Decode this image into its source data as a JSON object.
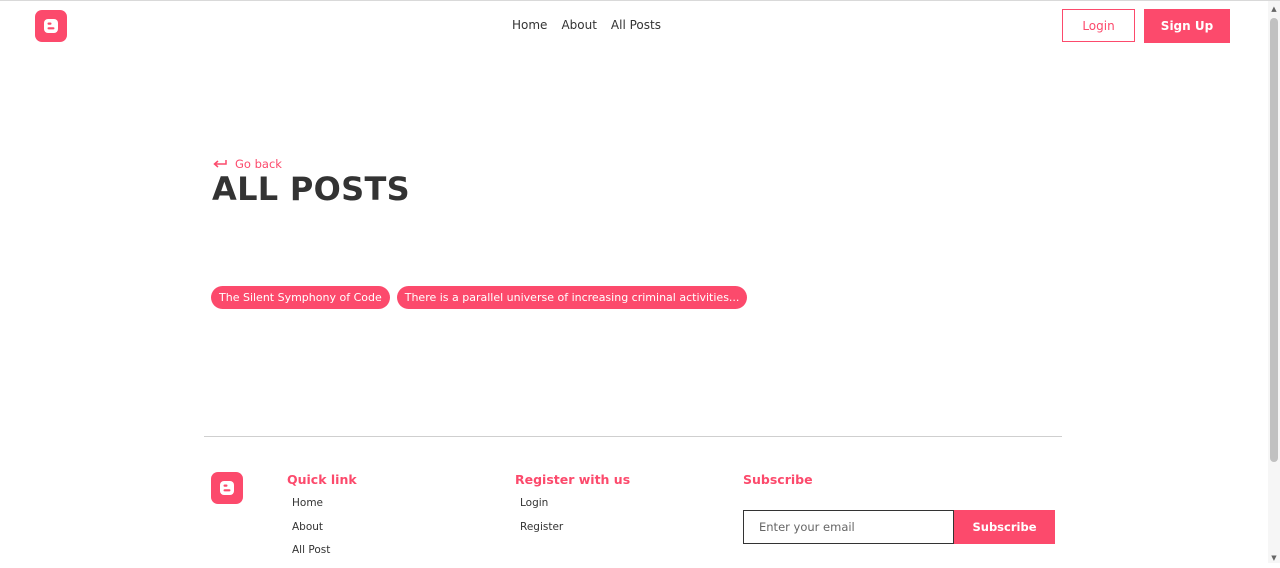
{
  "colors": {
    "accent": "#fc4a6c",
    "text": "#333333"
  },
  "header": {
    "logo_icon": "blogger-b-icon",
    "nav": [
      {
        "label": "Home"
      },
      {
        "label": "About"
      },
      {
        "label": "All Posts"
      }
    ],
    "login_label": "Login",
    "signup_label": "Sign Up"
  },
  "main": {
    "back_icon": "arrow-return-left-icon",
    "back_label": "Go back",
    "title": "ALL POSTS",
    "tags": [
      {
        "label": "The Silent Symphony of Code"
      },
      {
        "label": "There is a parallel universe of increasing criminal activities..."
      }
    ]
  },
  "footer": {
    "quick_link": {
      "heading": "Quick link",
      "links": [
        {
          "label": "Home"
        },
        {
          "label": "About"
        },
        {
          "label": "All Post"
        }
      ]
    },
    "register": {
      "heading": "Register with us",
      "links": [
        {
          "label": "Login"
        },
        {
          "label": "Register"
        }
      ]
    },
    "subscribe": {
      "heading": "Subscribe",
      "placeholder": "Enter your email",
      "button_label": "Subscribe"
    }
  }
}
